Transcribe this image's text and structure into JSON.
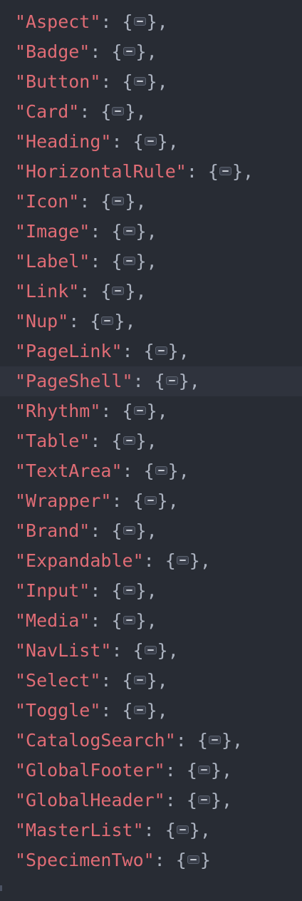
{
  "editor": {
    "active_line_index": 12,
    "lines": [
      {
        "key": "\"Aspect\"",
        "trailing": ","
      },
      {
        "key": "\"Badge\"",
        "trailing": ","
      },
      {
        "key": "\"Button\"",
        "trailing": ","
      },
      {
        "key": "\"Card\"",
        "trailing": ","
      },
      {
        "key": "\"Heading\"",
        "trailing": ","
      },
      {
        "key": "\"HorizontalRule\"",
        "trailing": ","
      },
      {
        "key": "\"Icon\"",
        "trailing": ","
      },
      {
        "key": "\"Image\"",
        "trailing": ","
      },
      {
        "key": "\"Label\"",
        "trailing": ","
      },
      {
        "key": "\"Link\"",
        "trailing": ","
      },
      {
        "key": "\"Nup\"",
        "trailing": ","
      },
      {
        "key": "\"PageLink\"",
        "trailing": ","
      },
      {
        "key": "\"PageShell\"",
        "trailing": ","
      },
      {
        "key": "\"Rhythm\"",
        "trailing": ","
      },
      {
        "key": "\"Table\"",
        "trailing": ","
      },
      {
        "key": "\"TextArea\"",
        "trailing": ","
      },
      {
        "key": "\"Wrapper\"",
        "trailing": ","
      },
      {
        "key": "\"Brand\"",
        "trailing": ","
      },
      {
        "key": "\"Expandable\"",
        "trailing": ","
      },
      {
        "key": "\"Input\"",
        "trailing": ","
      },
      {
        "key": "\"Media\"",
        "trailing": ","
      },
      {
        "key": "\"NavList\"",
        "trailing": ","
      },
      {
        "key": "\"Select\"",
        "trailing": ","
      },
      {
        "key": "\"Toggle\"",
        "trailing": ","
      },
      {
        "key": "\"CatalogSearch\"",
        "trailing": ","
      },
      {
        "key": "\"GlobalFooter\"",
        "trailing": ","
      },
      {
        "key": "\"GlobalHeader\"",
        "trailing": ","
      },
      {
        "key": "\"MasterList\"",
        "trailing": ","
      },
      {
        "key": "\"SpecimenTwo\"",
        "trailing": ""
      }
    ],
    "colors": {
      "background": "#282c34",
      "active_line": "#2f333d",
      "key": "#e06c75",
      "punctuation": "#abb2bf"
    },
    "icons": {
      "fold_marker": "collapsed-fold-icon"
    }
  }
}
